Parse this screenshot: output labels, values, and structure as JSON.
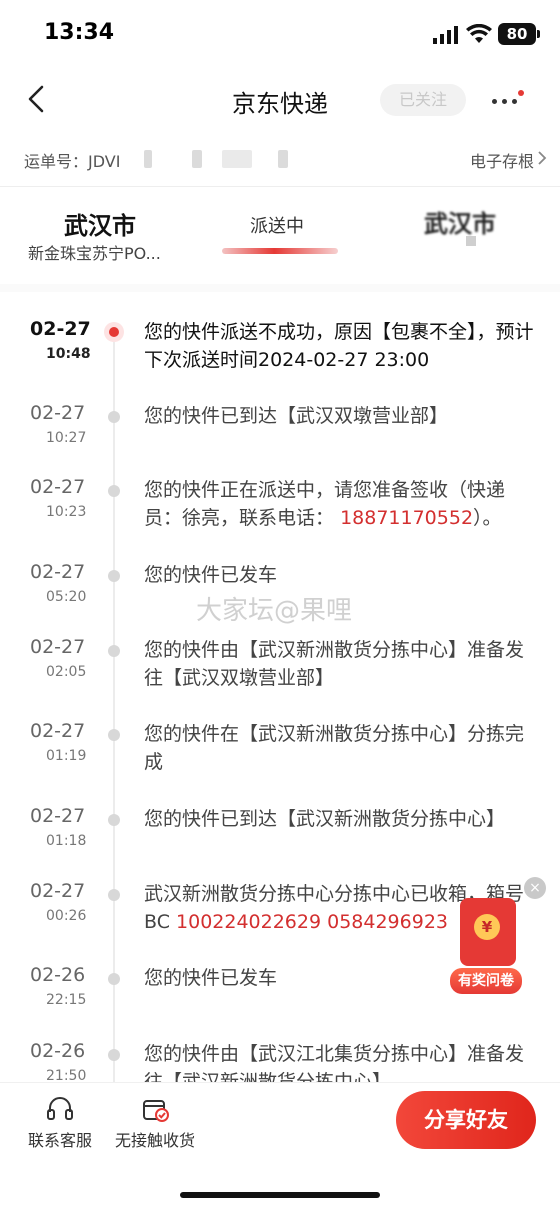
{
  "status_bar": {
    "time": "13:34",
    "battery": "80"
  },
  "nav": {
    "title": "京东快递",
    "follow_label": "已关注"
  },
  "waybill": {
    "label": "运单号：JDVI",
    "archive_label": "电子存根"
  },
  "route": {
    "from_city": "武汉市",
    "from_store": "新金珠宝苏宁PO...",
    "status": "派送中",
    "to_city": "武汉市"
  },
  "events": [
    {
      "date": "02-27",
      "time": "10:48",
      "text": "您的快件派送不成功，原因【包裹不全】，预计下次派送时间2024-02-27 23:00"
    },
    {
      "date": "02-27",
      "time": "10:27",
      "text": "您的快件已到达【武汉双墩营业部】"
    },
    {
      "date": "02-27",
      "time": "10:23",
      "text_before": "您的快件正在派送中，请您准备签收（快递员：徐亮，联系电话：",
      "phone": "18871170552",
      "text_after": "）。"
    },
    {
      "date": "02-27",
      "time": "05:20",
      "text": "您的快件已发车"
    },
    {
      "date": "02-27",
      "time": "02:05",
      "text": "您的快件由【武汉新洲散货分拣中心】准备发往【武汉双墩营业部】"
    },
    {
      "date": "02-27",
      "time": "01:19",
      "text": "您的快件在【武汉新洲散货分拣中心】分拣完成"
    },
    {
      "date": "02-27",
      "time": "01:18",
      "text": "您的快件已到达【武汉新洲散货分拣中心】"
    },
    {
      "date": "02-27",
      "time": "00:26",
      "text_before": "武汉新洲散货分拣中心分拣中心已收箱，箱号BC ",
      "box_code": "100224022629 0584296923"
    },
    {
      "date": "02-26",
      "time": "22:15",
      "text": "您的快件已发车"
    },
    {
      "date": "02-26",
      "time": "21:50",
      "text": "您的快件由【武汉江北集货分拣中心】准备发往【武汉新洲散货分拣中心】"
    }
  ],
  "watermark": "大家坛@果哩",
  "survey": {
    "coin": "¥",
    "label": "有奖问卷",
    "close": "×"
  },
  "bottom_bar": {
    "service_label": "联系客服",
    "contactless_label": "无接触收货",
    "share_label": "分享好友"
  },
  "colors": {
    "accent": "#e53935",
    "phone": "#d32f2f"
  },
  "icons": [
    "signal-icon",
    "wifi-icon",
    "back-arrow-icon",
    "more-dots-icon",
    "chevron-right-icon",
    "headset-icon",
    "parcel-check-icon",
    "red-envelope-icon"
  ]
}
